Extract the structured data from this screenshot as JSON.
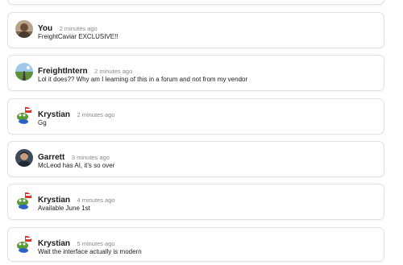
{
  "comments": [
    {
      "author": "You",
      "time": "2 minutes ago",
      "message": "FreightCaviar  EXCLUSIVE!!",
      "avatar": "user-photo-avatar"
    },
    {
      "author": "FreightIntern",
      "time": "2 minutes ago",
      "message": "Lol it does?? Why am I learning of this in a forum and not from my vendor",
      "avatar": "road-photo-avatar"
    },
    {
      "author": "Krystian",
      "time": "2 minutes ago",
      "message": "Gg",
      "avatar": "frog-cartoon-avatar"
    },
    {
      "author": "Garrett",
      "time": "3 minutes ago",
      "message": "McLeod has AI, it's so over",
      "avatar": "person-photo-avatar"
    },
    {
      "author": "Krystian",
      "time": "4 minutes ago",
      "message": "Available June 1st",
      "avatar": "frog-cartoon-avatar"
    },
    {
      "author": "Krystian",
      "time": "5 minutes ago",
      "message": "Wait the interface actually is modern",
      "avatar": "frog-cartoon-avatar"
    }
  ],
  "colors": {
    "border": "#e2e2e2",
    "text": "#1a1a1a",
    "muted": "#8a8a8a"
  }
}
